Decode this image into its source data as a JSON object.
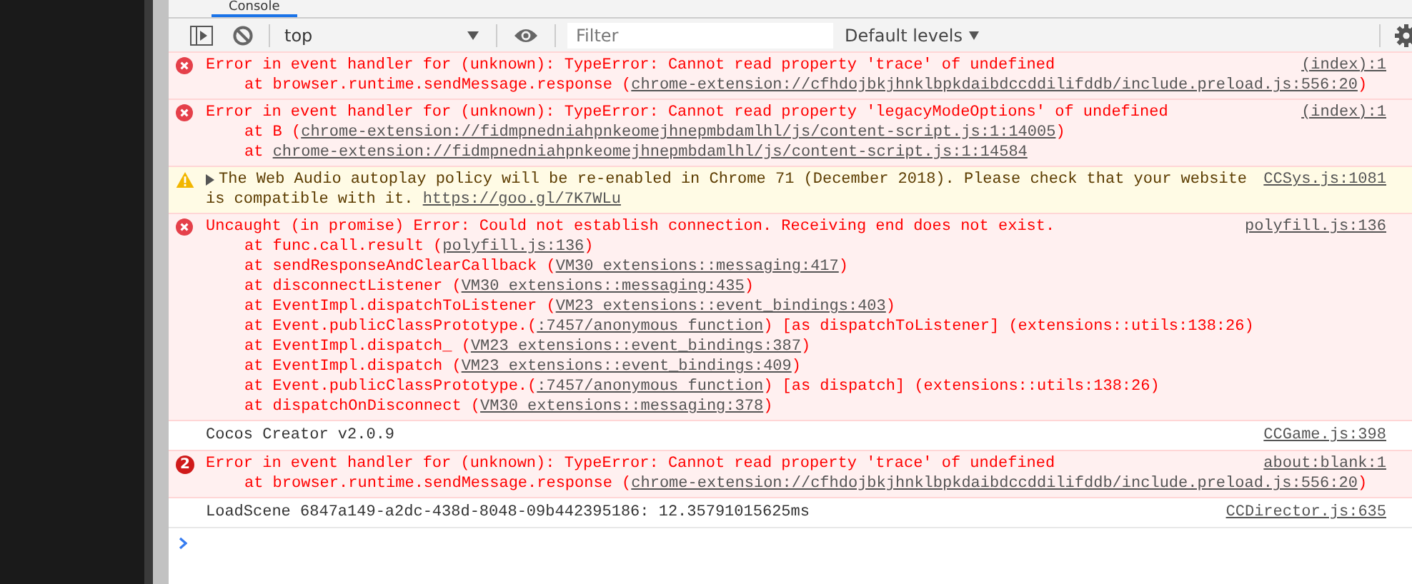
{
  "tabs": [
    {
      "label": "Console",
      "selected": true
    }
  ],
  "toolbar": {
    "context": "top",
    "filter": {
      "placeholder": "Filter"
    },
    "levels": "Default levels"
  },
  "messages": [
    {
      "kind": "error",
      "text": [
        [
          {
            "kind": "text",
            "text": "Error in event handler for (unknown): TypeError: Cannot read property 'trace' of undefined"
          }
        ]
      ],
      "stack": [
        [
          {
            "kind": "text",
            "text": "at browser.runtime.sendMessage.response ("
          },
          {
            "kind": "link",
            "text": "chrome-extension://cfhdojbkjhnklbpkdaibdccddilifddb/include.preload.js:556:20"
          },
          {
            "kind": "text",
            "text": ")"
          }
        ]
      ],
      "source": "(index):1"
    },
    {
      "kind": "error",
      "text": [
        [
          {
            "kind": "text",
            "text": "Error in event handler for (unknown): TypeError: Cannot read property 'legacyModeOptions' of undefined"
          }
        ]
      ],
      "stack": [
        [
          {
            "kind": "text",
            "text": "at B ("
          },
          {
            "kind": "link",
            "text": "chrome-extension://fidmpnedniahpnkeomejhnepmbdamlhl/js/content-script.js:1:14005"
          },
          {
            "kind": "text",
            "text": ")"
          }
        ],
        [
          {
            "kind": "text",
            "text": "at "
          },
          {
            "kind": "link",
            "text": "chrome-extension://fidmpnedniahpnkeomejhnepmbdamlhl/js/content-script.js:1:14584"
          }
        ]
      ],
      "source": "(index):1"
    },
    {
      "kind": "warning",
      "expanded": false,
      "text": [
        [
          {
            "kind": "text",
            "text": "The Web Audio autoplay policy will be re-enabled in Chrome 71 (December 2018). Please check that your website"
          }
        ],
        [
          {
            "kind": "text",
            "text": "is compatible with it. "
          },
          {
            "kind": "link",
            "text": "https://goo.gl/7K7WLu"
          }
        ]
      ],
      "source": "CCSys.js:1081"
    },
    {
      "kind": "error",
      "text": [
        [
          {
            "kind": "text",
            "text": "Uncaught (in promise) Error: Could not establish connection. Receiving end does not exist."
          }
        ]
      ],
      "stack": [
        [
          {
            "kind": "text",
            "text": "at func.call.result ("
          },
          {
            "kind": "link",
            "text": "polyfill.js:136"
          },
          {
            "kind": "text",
            "text": ")"
          }
        ],
        [
          {
            "kind": "text",
            "text": "at sendResponseAndClearCallback ("
          },
          {
            "kind": "link",
            "text": "VM30 extensions::messaging:417"
          },
          {
            "kind": "text",
            "text": ")"
          }
        ],
        [
          {
            "kind": "text",
            "text": "at disconnectListener ("
          },
          {
            "kind": "link",
            "text": "VM30 extensions::messaging:435"
          },
          {
            "kind": "text",
            "text": ")"
          }
        ],
        [
          {
            "kind": "text",
            "text": "at EventImpl.dispatchToListener ("
          },
          {
            "kind": "link",
            "text": "VM23 extensions::event_bindings:403"
          },
          {
            "kind": "text",
            "text": ")"
          }
        ],
        [
          {
            "kind": "text",
            "text": "at Event.publicClassPrototype.("
          },
          {
            "kind": "link",
            "text": ":7457/anonymous function"
          },
          {
            "kind": "text",
            "text": ") [as dispatchToListener] (extensions::utils:138:26)"
          }
        ],
        [
          {
            "kind": "text",
            "text": "at EventImpl.dispatch_ ("
          },
          {
            "kind": "link",
            "text": "VM23 extensions::event_bindings:387"
          },
          {
            "kind": "text",
            "text": ")"
          }
        ],
        [
          {
            "kind": "text",
            "text": "at EventImpl.dispatch ("
          },
          {
            "kind": "link",
            "text": "VM23 extensions::event_bindings:409"
          },
          {
            "kind": "text",
            "text": ")"
          }
        ],
        [
          {
            "kind": "text",
            "text": "at Event.publicClassPrototype.("
          },
          {
            "kind": "link",
            "text": ":7457/anonymous function"
          },
          {
            "kind": "text",
            "text": ") [as dispatch] (extensions::utils:138:26)"
          }
        ],
        [
          {
            "kind": "text",
            "text": "at dispatchOnDisconnect ("
          },
          {
            "kind": "link",
            "text": "VM30 extensions::messaging:378"
          },
          {
            "kind": "text",
            "text": ")"
          }
        ]
      ],
      "source": "polyfill.js:136"
    },
    {
      "kind": "info",
      "text": [
        [
          {
            "kind": "text",
            "text": "Cocos Creator v2.0.9"
          }
        ]
      ],
      "source": "CCGame.js:398"
    },
    {
      "kind": "error",
      "count": "2",
      "text": [
        [
          {
            "kind": "text",
            "text": "Error in event handler for (unknown): TypeError: Cannot read property 'trace' of undefined"
          }
        ]
      ],
      "stack": [
        [
          {
            "kind": "text",
            "text": "at browser.runtime.sendMessage.response ("
          },
          {
            "kind": "link",
            "text": "chrome-extension://cfhdojbkjhnklbpkdaibdccddilifddb/include.preload.js:556:20"
          },
          {
            "kind": "text",
            "text": ")"
          }
        ]
      ],
      "source": "about:blank:1"
    },
    {
      "kind": "info",
      "text": [
        [
          {
            "kind": "text",
            "text": "LoadScene 6847a149-a2dc-438d-8048-09b442395186: 12.35791015625ms"
          }
        ]
      ],
      "source": "CCDirector.js:635"
    }
  ]
}
